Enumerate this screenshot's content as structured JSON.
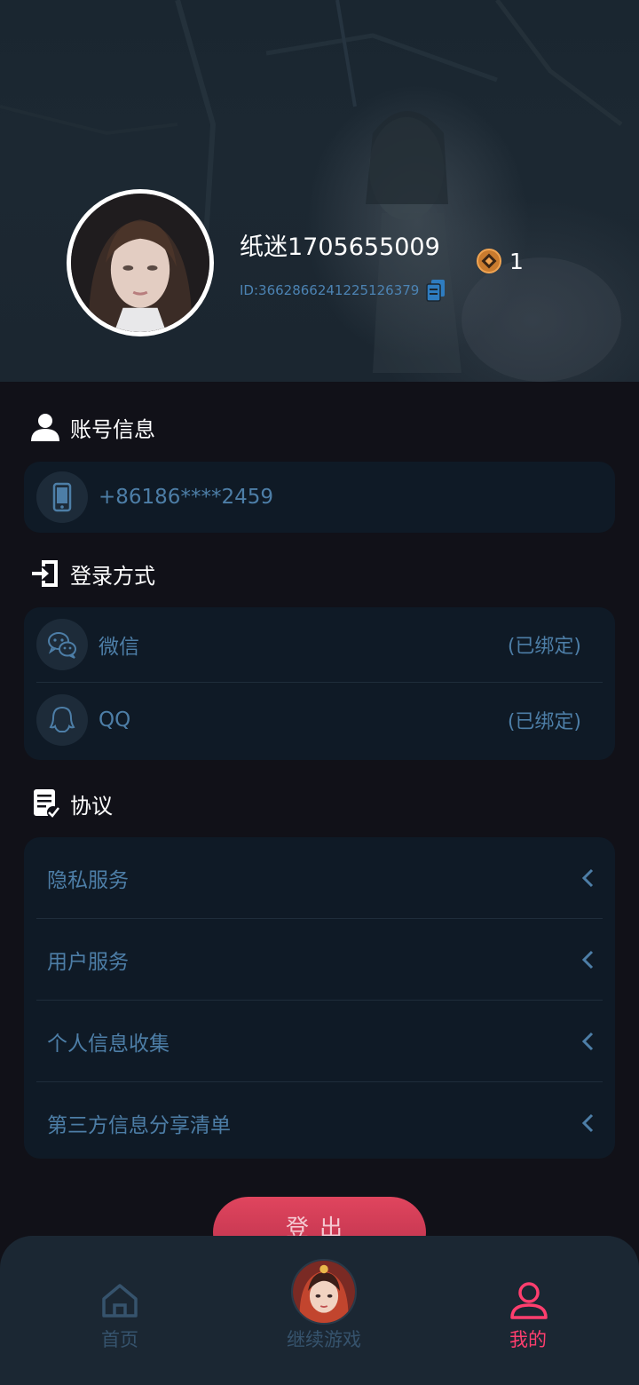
{
  "profile": {
    "username": "纸迷1705655009",
    "user_id": "ID:3662866241225126379",
    "coin_count": "1"
  },
  "account_section": {
    "title": "账号信息",
    "phone": "+86186****2459"
  },
  "login_section": {
    "title": "登录方式",
    "items": [
      {
        "name": "微信",
        "status": "(已绑定)",
        "icon": "wechat-icon"
      },
      {
        "name": "QQ",
        "status": "(已绑定)",
        "icon": "qq-icon"
      }
    ]
  },
  "agreement_section": {
    "title": "协议",
    "items": [
      {
        "label": "隐私服务"
      },
      {
        "label": "用户服务"
      },
      {
        "label": "个人信息收集"
      },
      {
        "label": "第三方信息分享清单"
      }
    ]
  },
  "logout_label": "登出",
  "tabbar": {
    "home": "首页",
    "continue": "继续游戏",
    "mine": "我的",
    "active": "mine",
    "active_color": "#ff3e6e",
    "inactive_color": "#36536d"
  },
  "colors": {
    "background": "#111118",
    "card": "#0f1a26",
    "link_text": "#4d7ea7",
    "logout_button": "#e0455e"
  }
}
